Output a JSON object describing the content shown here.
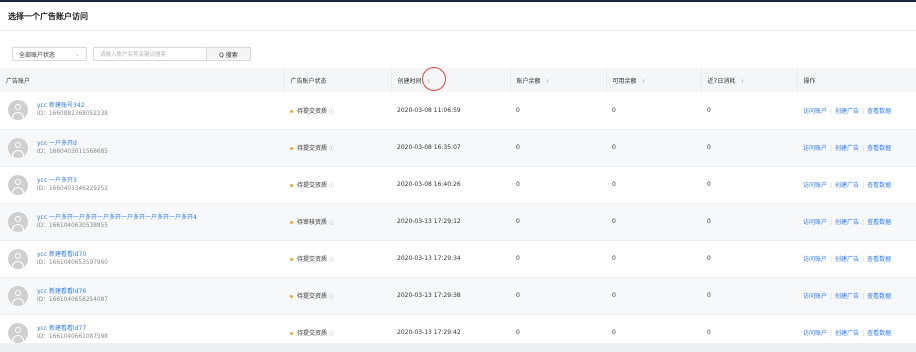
{
  "page": {
    "title": "选择一个广告账户访问"
  },
  "filters": {
    "status_select": "全部账户状态",
    "search_placeholder": "请输入账户名称关键词搜索",
    "search_button": "Q 搜索"
  },
  "table": {
    "headers": [
      "广告账户",
      "广告账户状态",
      "创建时间",
      "账户余额",
      "可用余额",
      "近7日消耗",
      "操作"
    ],
    "sortable": [
      false,
      false,
      true,
      true,
      true,
      true,
      false
    ],
    "ops": [
      "访问账户",
      "创建广告",
      "查看数据"
    ],
    "rows": [
      {
        "name": "ycc 新建账号342",
        "id": "ID：1660882368052238",
        "status": "待提交资质",
        "created": "2020-03-08 11:06:59",
        "balance": "0",
        "available": "0",
        "spend7": "0"
      },
      {
        "name": "ycc 一户多开d",
        "id": "ID：1660403011568685",
        "status": "待提交资质",
        "created": "2020-03-08 16:35:07",
        "balance": "0",
        "available": "0",
        "spend7": "0"
      },
      {
        "name": "ycc 一户多开3",
        "id": "ID：1660403346229252",
        "status": "待提交资质",
        "created": "2020-03-08 16:40:26",
        "balance": "0",
        "available": "0",
        "spend7": "0"
      },
      {
        "name": "ycc 一户多开一户多开一户多开一户多开一户多开一户多开4",
        "id": "ID：1661040630538855",
        "status": "待审核资质",
        "created": "2020-03-13 17:29:12",
        "balance": "0",
        "available": "0",
        "spend7": "0"
      },
      {
        "name": "ycc 新建看看ld70",
        "id": "ID：1661040653597960",
        "status": "待提交资质",
        "created": "2020-03-13 17:29:34",
        "balance": "0",
        "available": "0",
        "spend7": "0"
      },
      {
        "name": "ycc 新建看看ld76",
        "id": "ID：1661040658254087",
        "status": "待提交资质",
        "created": "2020-03-13 17:29:38",
        "balance": "0",
        "available": "0",
        "spend7": "0"
      },
      {
        "name": "ycc 新建看看ld77",
        "id": "ID：1661040661087598",
        "status": "待提交资质",
        "created": "2020-03-13 17:29:42",
        "balance": "0",
        "available": "0",
        "spend7": "0"
      }
    ]
  },
  "colors": {
    "link": "#2f7bf6",
    "status_dot": "#f5a623",
    "annotation_circle": "#e0453a"
  }
}
